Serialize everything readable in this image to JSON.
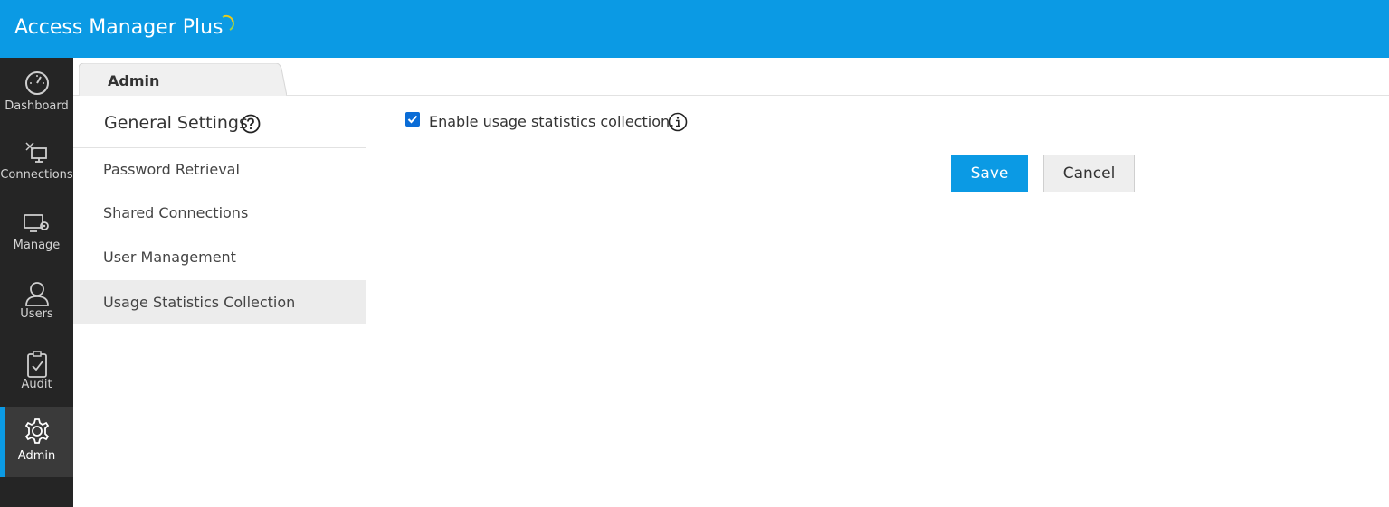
{
  "app": {
    "title": "Access Manager Plus",
    "brand_color": "#0b9ae4"
  },
  "leftnav": {
    "items": [
      {
        "label": "Dashboard",
        "icon": "gauge-icon"
      },
      {
        "label": "Connections",
        "icon": "connections-icon"
      },
      {
        "label": "Manage",
        "icon": "monitor-gear-icon"
      },
      {
        "label": "Users",
        "icon": "user-icon"
      },
      {
        "label": "Audit",
        "icon": "clipboard-check-icon"
      },
      {
        "label": "Admin",
        "icon": "gear-icon",
        "active": true
      }
    ]
  },
  "tabs": {
    "active_label": "Admin"
  },
  "sidemenu": {
    "header": "General Settings",
    "help_icon": "question-circle-icon",
    "items": [
      {
        "label": "Password Retrieval"
      },
      {
        "label": "Shared Connections"
      },
      {
        "label": "User Management"
      },
      {
        "label": "Usage Statistics Collection",
        "active": true
      }
    ]
  },
  "form": {
    "checkbox_label": "Enable usage statistics collection.",
    "checkbox_checked": true,
    "info_icon": "info-circle-icon",
    "save_label": "Save",
    "cancel_label": "Cancel"
  }
}
